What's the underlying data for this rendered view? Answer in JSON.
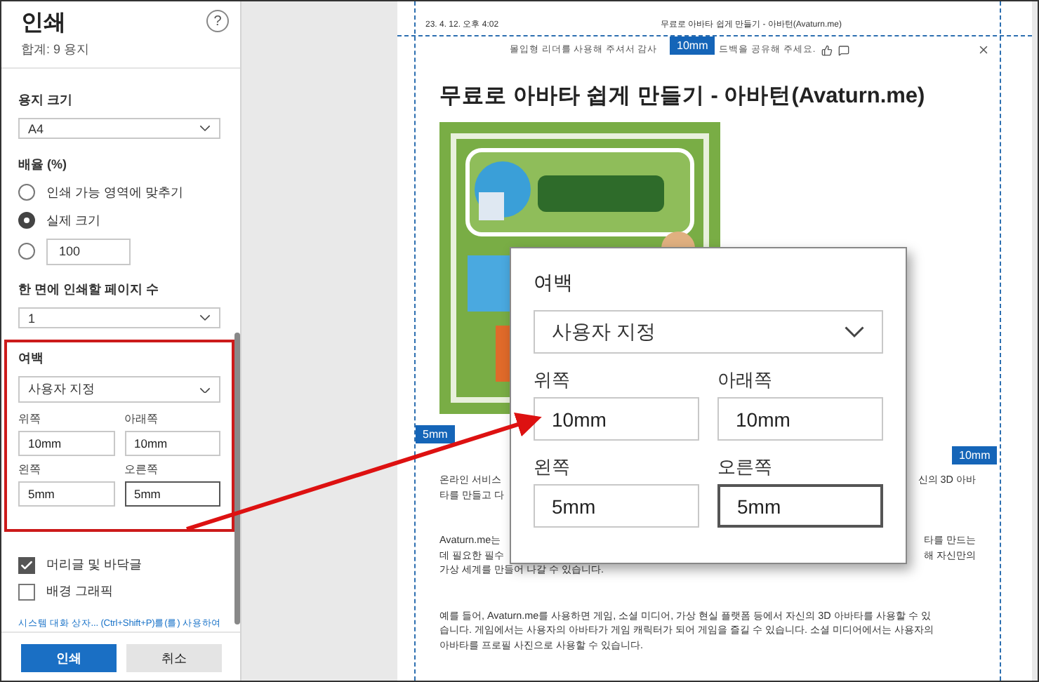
{
  "panel": {
    "title": "인쇄",
    "subtitle": "합계: 9 용지",
    "help": "?"
  },
  "paper_size": {
    "label": "용지 크기",
    "value": "A4"
  },
  "scale": {
    "label": "배율 (%)",
    "options": [
      {
        "kind": "radio",
        "label": "인쇄 가능 영역에 맞추기",
        "selected": false
      },
      {
        "kind": "radio",
        "label": "실제 크기",
        "selected": true
      },
      {
        "kind": "input",
        "value": "100",
        "selected": false
      }
    ]
  },
  "pages_per_sheet": {
    "label": "한 면에 인쇄할 페이지 수",
    "value": "1"
  },
  "margins": {
    "label": "여백",
    "value": "사용자 지정",
    "fields": [
      {
        "label": "위쪽",
        "value": "10mm",
        "focused": false
      },
      {
        "label": "아래쪽",
        "value": "10mm",
        "focused": false
      },
      {
        "label": "왼쪽",
        "value": "5mm",
        "focused": false
      },
      {
        "label": "오른쪽",
        "value": "5mm",
        "focused": true
      }
    ]
  },
  "options": [
    {
      "label": "머리글 및 바닥글",
      "checked": true
    },
    {
      "label": "배경 그래픽",
      "checked": false
    }
  ],
  "system_dialog_link": "시스템 대화 상자... (Ctrl+Shift+P)를(를) 사용하여",
  "buttons": [
    {
      "label": "인쇄",
      "kind": "primary"
    },
    {
      "label": "취소",
      "kind": "secondary"
    }
  ],
  "preview": {
    "header_date": "23. 4. 12. 오후 4:02",
    "header_title": "무료로 아바타 쉽게 만들기 - 아바턴(Avaturn.me)",
    "reader_notice": [
      "몰입형 리더를 사용해 주셔서 감사",
      "드백을 공유해 주세요."
    ],
    "article_title": "무료로 아바타 쉽게 만들기 - 아바턴(Avaturn.me)",
    "paragraphs": [
      [
        {
          "kind": "split",
          "left": "온라인 서비스",
          "right": "신의 3D 아바"
        },
        {
          "kind": "split",
          "left": "타를 만들고 다"
        }
      ],
      [
        {
          "kind": "split",
          "left": "Avaturn.me는",
          "right": "타를 만드는"
        },
        {
          "kind": "split",
          "left": "데 필요한 필수",
          "right": "해 자신만의"
        },
        {
          "kind": "full",
          "text": "가상 세계를 만들어 나갈 수 있습니다."
        }
      ],
      [
        {
          "kind": "full",
          "text": "예를 들어, Avaturn.me를 사용하면 게임, 소셜 미디어, 가상 현실 플랫폼 등에서 자신의 3D 아바타를 사용할 수 있"
        },
        {
          "kind": "full",
          "text": "습니다. 게임에서는 사용자의 아바타가 게임 캐릭터가 되어 게임을 즐길 수 있습니다. 소셜 미디어에서는 사용자의"
        },
        {
          "kind": "full",
          "text": "아바타를 프로필 사진으로 사용할 수 있습니다."
        }
      ]
    ],
    "margin_badges": [
      {
        "label": "10mm"
      },
      {
        "label": "5mm"
      },
      {
        "label": "10mm"
      }
    ]
  },
  "zoom_inset": {
    "label": "여백",
    "value": "사용자 지정",
    "fields": [
      {
        "label": "위쪽",
        "value": "10mm",
        "focused": false
      },
      {
        "label": "아래쪽",
        "value": "10mm",
        "focused": false
      },
      {
        "label": "왼쪽",
        "value": "5mm",
        "focused": false
      },
      {
        "label": "오른쪽",
        "value": "5mm",
        "focused": true
      }
    ]
  }
}
